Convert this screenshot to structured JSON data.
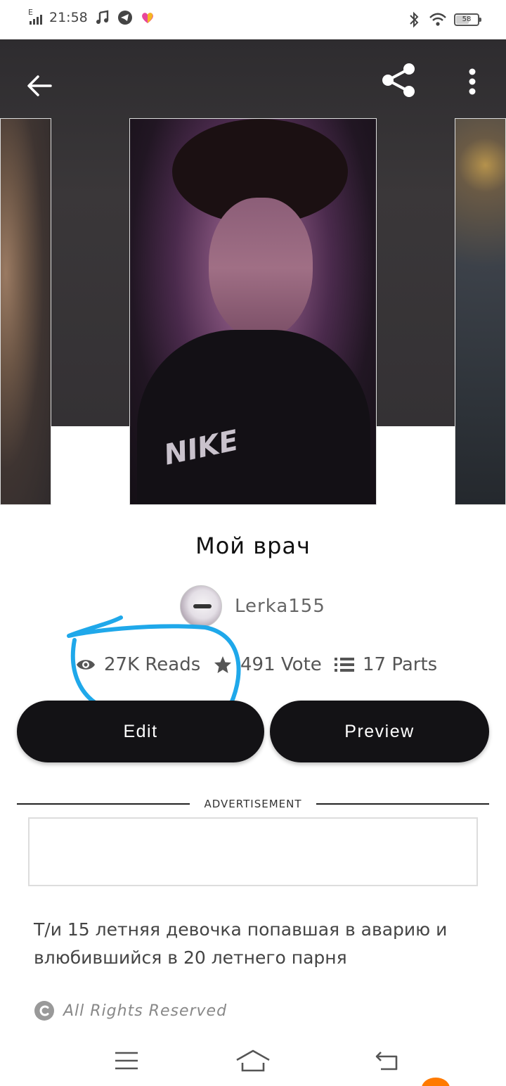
{
  "status_bar": {
    "network_type": "E",
    "time": "21:58",
    "battery": "58",
    "icons": [
      "music-icon",
      "telegram-icon",
      "heart-app-icon",
      "bluetooth-icon",
      "wifi-icon",
      "battery-icon"
    ]
  },
  "toolbar": {
    "icons": [
      "back-arrow-icon",
      "share-icon",
      "more-vertical-icon"
    ]
  },
  "story": {
    "title": "Мой врач",
    "author": "Lerka155",
    "cover_logo": "NIKE"
  },
  "stats": {
    "reads": "27K Reads",
    "votes": "491 Vote",
    "parts": "17 Parts"
  },
  "actions": {
    "edit_label": "Edit",
    "preview_label": "Preview"
  },
  "ad": {
    "label": "ADVERTISEMENT"
  },
  "description": "Т/и 15 летняя девочка попавшая в аварию и влюбившийся в 20 летнего парня",
  "rights": {
    "text": "All Rights Reserved"
  },
  "colors": {
    "button_bg": "#131215",
    "annotation": "#1fa8ea",
    "hero_bg": "#343134"
  }
}
